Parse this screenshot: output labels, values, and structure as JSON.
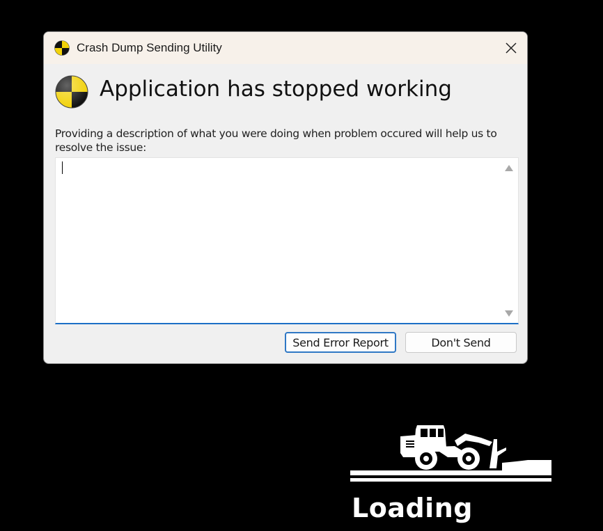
{
  "dialog": {
    "title": "Crash Dump Sending Utility",
    "heading": "Application has stopped working",
    "description": "Providing a description of what you were doing when problem occured will help us to resolve the issue:",
    "textarea_value": "",
    "buttons": {
      "send": "Send Error Report",
      "dont_send": "Don't Send"
    },
    "icons": {
      "app": "crash-test-dummy-icon",
      "close": "close-icon"
    },
    "colors": {
      "accent": "#1c6fc6",
      "icon_yellow": "#f2d20a",
      "icon_black": "#111111"
    }
  },
  "loading": {
    "label": "Loading",
    "icon": "wheel-loader-icon"
  }
}
